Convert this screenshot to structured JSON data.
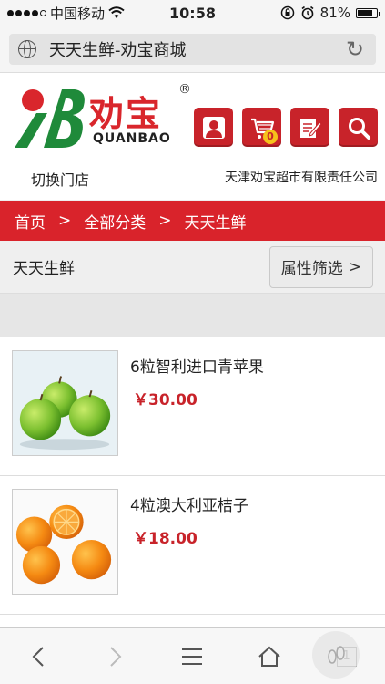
{
  "status_bar": {
    "carrier": "中国移动",
    "time": "10:58",
    "battery": "81%",
    "battery_level": 0.81
  },
  "browser": {
    "page_title": "天天生鲜-劝宝商城"
  },
  "header": {
    "logo_cn": "劝宝",
    "logo_registered": "®",
    "logo_en": "QUANBAO",
    "switch_store": "切换门店",
    "company": "天津劝宝超市有限责任公司",
    "cart_count": "0",
    "brand_color": "#d9232b",
    "icons": [
      "user-icon",
      "cart-icon",
      "edit-icon",
      "search-icon"
    ]
  },
  "breadcrumb": {
    "items": [
      "首页",
      "全部分类",
      "天天生鲜"
    ],
    "separator": ">"
  },
  "category": {
    "title": "天天生鲜",
    "filter_label": "属性筛选",
    "filter_arrow": ">"
  },
  "products": [
    {
      "name": "6粒智利进口青苹果",
      "price": "￥30.00",
      "image": "green-apples"
    },
    {
      "name": "4粒澳大利亚桔子",
      "price": "￥18.00",
      "image": "oranges"
    }
  ],
  "toolbar": {
    "icons": [
      "back-icon",
      "forward-icon",
      "menu-icon",
      "home-icon",
      "tabs-icon"
    ],
    "tabs_count": "1"
  }
}
